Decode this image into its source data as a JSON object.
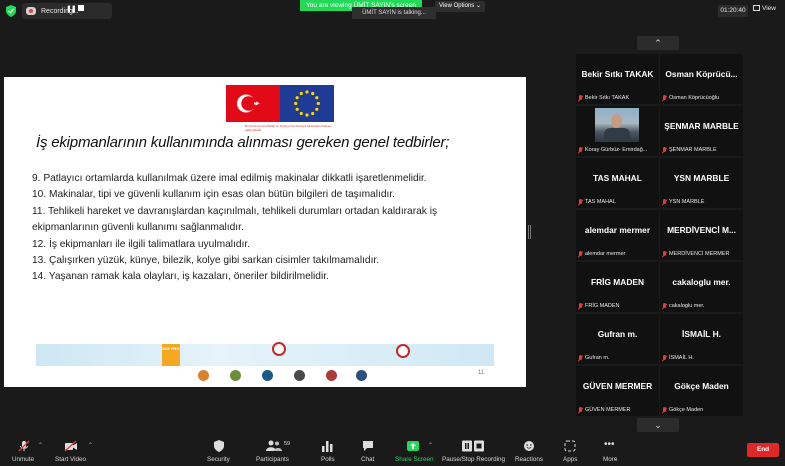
{
  "topbar": {
    "recording_label": "Recording...",
    "viewing_banner": "You are viewing ÜMİT SAYIN's screen",
    "talking_banner": "ÜMİT SAYIN is talking...",
    "view_options_label": "View Options ⌄",
    "timer": "01:20:40",
    "view_label": "View"
  },
  "slide": {
    "caption": "Bu Proje Avrupa Birliği ve Türkiye Cumhuriyeti tarafından finanse edilmektedir",
    "title": "İş ekipmanlarının kullanımında alınması gereken genel tedbirler;",
    "items": [
      "9. Patlayıcı ortamlarda kullanılmak üzere imal edilmiş makinalar dikkatli işaretlenmelidir.",
      "10. Makinalar, tipi ve güvenli kullanım için esas olan bütün bilgileri de taşımalıdır.",
      "11. Tehlikeli hareket ve davranışlardan kaçınılmalı, tehlikeli durumları ortadan kaldırarak iş ekipmanlarının güvenli kullanımı sağlanmalıdır.",
      "12. İş ekipmanları ile ilgili talimatlara uyulmalıdır.",
      "13. Çalışırken yüzük, künye, bilezik, kolye gibi sarkan cisimler takılmamalıdır.",
      "14. Yaşanan ramak kala olayları, iş kazaları, öneriler bildirilmelidir."
    ],
    "ikg_logo": "İKG PRO",
    "page_number": "11"
  },
  "participants": [
    {
      "name": "Bekir Sıtkı TAKAK",
      "footer": "Bekir Sıtkı TAKAK"
    },
    {
      "name": "Osman  Köprücü...",
      "footer": "Osman Köprücüoğlu"
    },
    {
      "name": "",
      "footer": "Koray Gürbüz- Emirdağ..."
    },
    {
      "name": "ŞENMAR MARBLE",
      "footer": "ŞENMAR MARBLE"
    },
    {
      "name": "TAS MAHAL",
      "footer": "TAS MAHAL"
    },
    {
      "name": "YSN MARBLE",
      "footer": "YSN MARBLE"
    },
    {
      "name": "alemdar mermer",
      "footer": "alemdar mermer"
    },
    {
      "name": "MERDİVENCİ  M...",
      "footer": "MERDİVENCİ MERMER"
    },
    {
      "name": "FRİG MADEN",
      "footer": "FRİG MADEN"
    },
    {
      "name": "cakaloglu mer.",
      "footer": "cakaloglu mer."
    },
    {
      "name": "Gufran m.",
      "footer": "Gufran m."
    },
    {
      "name": "İSMAİL H.",
      "footer": "İSMAİL H."
    },
    {
      "name": "GÜVEN MERMER",
      "footer": "GÜVEN MERMER"
    },
    {
      "name": "Gökçe Maden",
      "footer": "Gökçe Maden"
    }
  ],
  "toolbar": {
    "unmute": "Unmute",
    "start_video": "Start Video",
    "security": "Security",
    "participants": "Participants",
    "participants_count": "59",
    "polls": "Polls",
    "chat": "Chat",
    "share_screen": "Share Screen",
    "pause_stop_recording": "Pause/Stop Recording",
    "reactions": "Reactions",
    "apps": "Apps",
    "more": "More",
    "end": "End"
  },
  "colors": {
    "viewing_banner": "#23d959",
    "end_button": "#e02828",
    "mute_icon": "#e33b3b"
  }
}
